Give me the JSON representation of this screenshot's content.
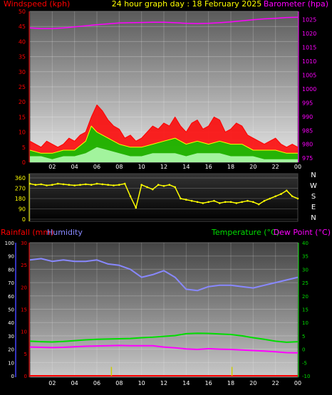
{
  "header": {
    "left_label": "Windspeed (kph)",
    "title": "24 hour graph day : 18 February 2025",
    "right_label": "Barometer (hpa)"
  },
  "colors": {
    "windspeed": "#ff0000",
    "gust_avg": "#ffff00",
    "wind_green": "#00cc00",
    "wind_light": "#b8ffb8",
    "barometer": "#ff00ff",
    "direction": "#ffff00",
    "rainfall": "#ff0000",
    "humidity": "#8888ff",
    "temperature": "#00dd00",
    "dewpoint": "#ff00ff",
    "rain_event": "#cccc00",
    "left_axis_wind": "#ff0000",
    "right_axis_baro": "#ff00ff"
  },
  "chart_data": [
    {
      "type": "line",
      "panel": "wind_barometer",
      "x_ticks": [
        "02",
        "04",
        "06",
        "08",
        "10",
        "12",
        "14",
        "16",
        "18",
        "20",
        "22",
        "00"
      ],
      "y_left": {
        "label": "Windspeed (kph)",
        "ticks": [
          0,
          5,
          10,
          15,
          20,
          25,
          30,
          35,
          40,
          45,
          50
        ],
        "range": [
          0,
          50
        ]
      },
      "y_right": {
        "label": "Barometer (hpa)",
        "ticks": [
          975,
          980,
          985,
          990,
          995,
          1000,
          1005,
          1010,
          1015,
          1020,
          1025
        ],
        "range": [
          973.5,
          1028
        ]
      },
      "series": [
        {
          "name": "Barometer (hpa)",
          "axis": "right",
          "x": [
            0,
            1,
            2,
            3,
            4,
            5,
            6,
            7,
            8,
            9,
            10,
            11,
            12,
            13,
            14,
            15,
            16,
            17,
            18,
            19,
            20,
            21,
            22,
            23,
            24
          ],
          "y": [
            1022,
            1021.8,
            1021.8,
            1022,
            1022.4,
            1022.8,
            1023.2,
            1023.5,
            1023.8,
            1023.9,
            1024,
            1024.1,
            1024.1,
            1023.9,
            1023.7,
            1023.6,
            1023.7,
            1023.9,
            1024.2,
            1024.6,
            1025,
            1025.3,
            1025.5,
            1025.8,
            1025.9
          ]
        },
        {
          "name": "Windspeed (kph)",
          "axis": "left",
          "x": [
            0,
            0.5,
            1,
            1.5,
            2,
            2.5,
            3,
            3.5,
            4,
            4.5,
            5,
            5.5,
            6,
            6.5,
            7,
            7.5,
            8,
            8.5,
            9,
            9.5,
            10,
            10.5,
            11,
            11.5,
            12,
            12.5,
            13,
            13.5,
            14,
            14.5,
            15,
            15.5,
            16,
            16.5,
            17,
            17.5,
            18,
            18.5,
            19,
            19.5,
            20,
            20.5,
            21,
            21.5,
            22,
            22.5,
            23,
            23.5,
            24
          ],
          "y": [
            7,
            6,
            5,
            7,
            6,
            5,
            6,
            8,
            7,
            9,
            10,
            15,
            19,
            17,
            14,
            12,
            11,
            8,
            9,
            7,
            8,
            10,
            12,
            11,
            13,
            12,
            15,
            12,
            10,
            13,
            14,
            11,
            12,
            15,
            14,
            10,
            11,
            13,
            12,
            9,
            8,
            7,
            6,
            7,
            8,
            6,
            5,
            6,
            5
          ]
        },
        {
          "name": "Gust (kph)",
          "axis": "left",
          "x": [
            0,
            1,
            2,
            3,
            4,
            5,
            5.5,
            6,
            6.5,
            7,
            8,
            9,
            10,
            11,
            12,
            13,
            14,
            15,
            16,
            17,
            18,
            19,
            20,
            21,
            22,
            23,
            24
          ],
          "y": [
            4,
            3,
            3,
            4,
            4,
            7,
            12,
            10,
            9,
            8,
            6,
            5,
            5,
            6,
            7,
            8,
            6,
            7,
            6,
            7,
            6,
            6,
            4,
            4,
            4,
            3,
            3
          ]
        },
        {
          "name": "Average (kph)",
          "axis": "left",
          "x": [
            0,
            1,
            2,
            3,
            4,
            5,
            6,
            7,
            8,
            9,
            10,
            11,
            12,
            13,
            14,
            15,
            16,
            17,
            18,
            19,
            20,
            21,
            22,
            23,
            24
          ],
          "y": [
            2,
            2,
            1,
            2,
            2,
            3,
            5,
            4,
            3,
            2,
            2,
            3,
            3,
            3,
            2,
            3,
            3,
            3,
            2,
            2,
            2,
            1,
            1,
            1,
            1
          ]
        }
      ]
    },
    {
      "type": "scatter",
      "panel": "wind_direction",
      "y_ticks": [
        0,
        90,
        180,
        270,
        360
      ],
      "y_range": [
        0,
        360
      ],
      "compass_labels": [
        "N",
        "W",
        "S",
        "E",
        "N"
      ],
      "series": [
        {
          "name": "Wind direction",
          "x": [
            0,
            0.5,
            1,
            1.5,
            2,
            2.5,
            3,
            3.5,
            4,
            4.5,
            5,
            5.5,
            6,
            6.5,
            7,
            7.5,
            8,
            8.5,
            9,
            9.5,
            10,
            10.5,
            11,
            11.5,
            12,
            12.5,
            13,
            13.5,
            14,
            14.5,
            15,
            15.5,
            16,
            16.5,
            17,
            17.5,
            18,
            18.5,
            19,
            19.5,
            20,
            20.5,
            21,
            21.5,
            22,
            22.5,
            23,
            23.5,
            24
          ],
          "y": [
            310,
            300,
            305,
            295,
            300,
            310,
            305,
            300,
            295,
            300,
            305,
            300,
            310,
            305,
            300,
            295,
            300,
            310,
            200,
            100,
            300,
            280,
            260,
            300,
            290,
            300,
            280,
            180,
            170,
            160,
            150,
            140,
            150,
            160,
            140,
            150,
            150,
            140,
            150,
            160,
            150,
            130,
            160,
            180,
            200,
            220,
            250,
            200,
            180
          ]
        }
      ]
    },
    {
      "type": "line",
      "panel": "rain_humidity_temperature",
      "x_ticks": [
        "02",
        "04",
        "06",
        "08",
        "10",
        "12",
        "14",
        "16",
        "18",
        "20",
        "22",
        "00"
      ],
      "labels": {
        "rainfall": "Rainfall (mm)",
        "humidity": "Humidity",
        "temperature": "Temperature (°C)",
        "dewpoint": "Dew Point (°C)"
      },
      "y_humidity": {
        "ticks": [
          0,
          10,
          20,
          30,
          40,
          50,
          60,
          70,
          80,
          90,
          100
        ],
        "range": [
          0,
          100
        ]
      },
      "y_rain": {
        "ticks": [
          0,
          5,
          10,
          15,
          20,
          25,
          30
        ],
        "range": [
          0,
          30
        ]
      },
      "y_temp": {
        "ticks": [
          -10,
          -5,
          0,
          5,
          10,
          15,
          20,
          25,
          30,
          35,
          40
        ],
        "range": [
          -10,
          40
        ]
      },
      "series": [
        {
          "name": "Humidity",
          "axis": "humidity",
          "x": [
            0,
            1,
            2,
            3,
            4,
            5,
            6,
            7,
            8,
            9,
            10,
            11,
            12,
            13,
            14,
            15,
            16,
            17,
            18,
            19,
            20,
            21,
            22,
            23,
            24
          ],
          "y": [
            87,
            88,
            86,
            87,
            86,
            86,
            87,
            84,
            83,
            80,
            74,
            76,
            79,
            74,
            65,
            64,
            67,
            68,
            68,
            67,
            66,
            68,
            70,
            72,
            74
          ]
        },
        {
          "name": "Temperature (°C)",
          "axis": "temp",
          "x": [
            0,
            1,
            2,
            3,
            4,
            5,
            6,
            7,
            8,
            9,
            10,
            11,
            12,
            13,
            14,
            15,
            16,
            17,
            18,
            19,
            20,
            21,
            22,
            23,
            24
          ],
          "y": [
            3,
            2.8,
            2.7,
            2.9,
            3.2,
            3.5,
            3.7,
            3.8,
            3.9,
            4,
            4.3,
            4.5,
            4.8,
            5.1,
            5.8,
            6,
            5.9,
            5.7,
            5.5,
            5,
            4.3,
            3.7,
            3,
            2.6,
            2.8
          ]
        },
        {
          "name": "Dew Point (°C)",
          "axis": "temp",
          "x": [
            0,
            1,
            2,
            3,
            4,
            5,
            6,
            7,
            8,
            9,
            10,
            11,
            12,
            13,
            14,
            15,
            16,
            17,
            18,
            19,
            20,
            21,
            22,
            23,
            24
          ],
          "y": [
            0.8,
            0.7,
            0.6,
            0.7,
            0.9,
            1.1,
            1.2,
            1.3,
            1.4,
            1.3,
            1.3,
            1.3,
            0.8,
            0.5,
            0.1,
            -0.1,
            0.2,
            0,
            -0.1,
            -0.3,
            -0.5,
            -0.7,
            -1,
            -1.3,
            -1.4
          ]
        },
        {
          "name": "Rainfall (mm)",
          "axis": "rain",
          "x": [
            0,
            24
          ],
          "y": [
            0,
            0
          ]
        }
      ],
      "rain_events": [
        {
          "x": 7.3,
          "value": 2
        },
        {
          "x": 18.1,
          "value": 2
        }
      ]
    }
  ]
}
